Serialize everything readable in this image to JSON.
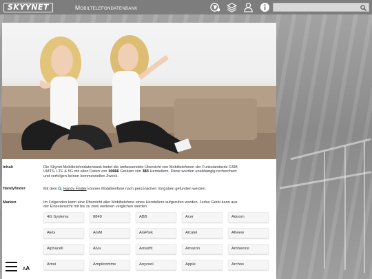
{
  "header": {
    "logo_text": "SKYYNET",
    "app_title": "Mobiltelefondatenbank",
    "icons": [
      "globe-icon",
      "layers-icon",
      "user-icon",
      "info-icon"
    ],
    "search": {
      "placeholder": "",
      "value": ""
    }
  },
  "sections": [
    {
      "label": "Inhalt",
      "text_before": "Die Skynet Mobiltelefondatenbank bietet die umfassendste Übersicht von Mobiltelefonen der Funkstandards GSM, UMTS, LTE & 5G mit allen Daten von ",
      "devices": "10666",
      "text_middle": " Geräten von ",
      "manufacturers": "383",
      "text_after": " Herstellern. Diese wurden unabhängig recherchiert und verfolgen keinen kommerziellen Zweck."
    },
    {
      "label": "Handyfinder",
      "text_before": "Mit dem ",
      "link": "Handy Finder",
      "text_after": " können Mobiltelefone nach persönlichen Vorgaben gefunden werden."
    },
    {
      "label": "Marken",
      "text": "Im Folgenden kann eine Übersicht aller Mobiltelefone eines Herstellers aufgerufen werden. Jedes Gerät kann aus der Einzelansicht mit bis zu zwei weiteren verglichen werden"
    }
  ],
  "brands": [
    "4G Systems",
    "8849",
    "ABB",
    "Acer",
    "Adoorn",
    "AEG",
    "AGM",
    "AGPtek",
    "Alcatel",
    "Allview",
    "Alphacell",
    "Alva",
    "Amazfit",
    "Amazon",
    "Ambience",
    "Amoi",
    "Ampilcomms",
    "Anycool",
    "Apple",
    "Archos"
  ],
  "footer": {
    "font_small": "A",
    "font_large": "A"
  }
}
